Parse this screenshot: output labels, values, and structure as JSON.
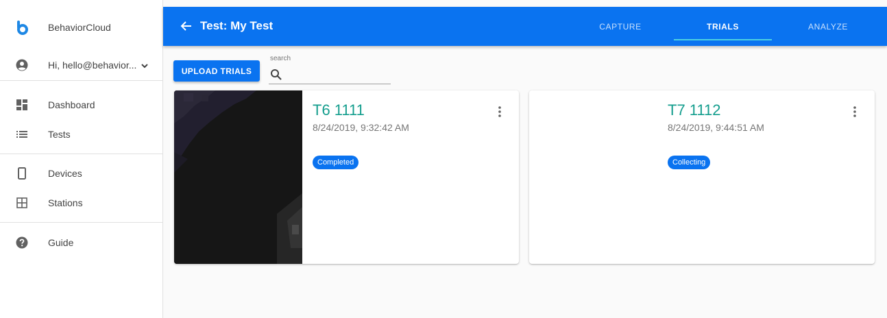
{
  "sidebar": {
    "brand": "BehaviorCloud",
    "user_greeting": "Hi, hello@behavior...",
    "items": [
      {
        "label": "Dashboard",
        "icon": "dashboard-icon"
      },
      {
        "label": "Tests",
        "icon": "list-icon"
      },
      {
        "label": "Devices",
        "icon": "phone-icon"
      },
      {
        "label": "Stations",
        "icon": "grid-icon"
      },
      {
        "label": "Guide",
        "icon": "help-icon"
      }
    ]
  },
  "header": {
    "title": "Test: My Test",
    "tabs": [
      {
        "label": "CAPTURE",
        "active": false
      },
      {
        "label": "TRIALS",
        "active": true
      },
      {
        "label": "ANALYZE",
        "active": false
      }
    ]
  },
  "toolbar": {
    "upload_label": "UPLOAD TRIALS",
    "search_label": "search",
    "search_value": ""
  },
  "trials": [
    {
      "name": "T6 1111",
      "date": "8/24/2019, 9:32:42 AM",
      "status": "Completed",
      "has_thumbnail": true
    },
    {
      "name": "T7 1112",
      "date": "8/24/2019, 9:44:51 AM",
      "status": "Collecting",
      "has_thumbnail": false
    }
  ],
  "colors": {
    "primary": "#0a73f0",
    "trial_name": "#159e8e",
    "tab_indicator": "#4dd0e1"
  }
}
